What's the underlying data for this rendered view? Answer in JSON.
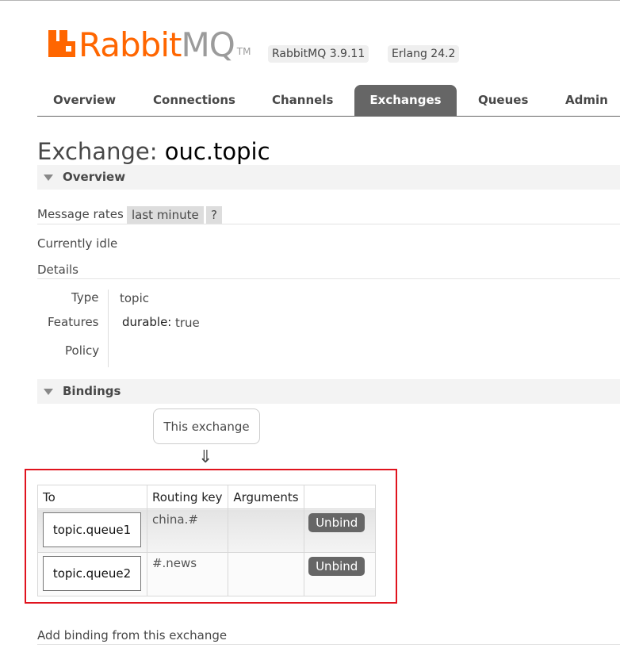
{
  "header": {
    "logo_rabbit": "Rabbit",
    "logo_mq": "MQ",
    "logo_tm": "TM",
    "version": "RabbitMQ 3.9.11",
    "erlang": "Erlang 24.2"
  },
  "nav": {
    "tabs": [
      "Overview",
      "Connections",
      "Channels",
      "Exchanges",
      "Queues",
      "Admin"
    ],
    "active": "Exchanges"
  },
  "page": {
    "title_prefix": "Exchange:",
    "exchange_name": "ouc.topic"
  },
  "overview": {
    "section_label": "Overview",
    "message_rates_label": "Message rates",
    "rates_range": "last minute",
    "help": "?",
    "status": "Currently idle",
    "details_label": "Details",
    "type_label": "Type",
    "type_value": "topic",
    "features_label": "Features",
    "feature_key": "durable:",
    "feature_value": "true",
    "policy_label": "Policy"
  },
  "bindings": {
    "section_label": "Bindings",
    "this_exchange": "This exchange",
    "arrow": "⇓",
    "columns": [
      "To",
      "Routing key",
      "Arguments",
      ""
    ],
    "rows": [
      {
        "to": "topic.queue1",
        "routing_key": "china.#",
        "arguments": "",
        "action": "Unbind"
      },
      {
        "to": "topic.queue2",
        "routing_key": "#.news",
        "arguments": "",
        "action": "Unbind"
      }
    ],
    "add_binding": "Add binding from this exchange"
  }
}
